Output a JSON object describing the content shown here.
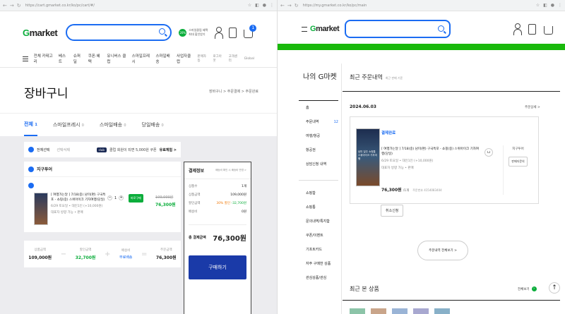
{
  "left": {
    "browser": {
      "url": "https://cart.gmarket.co.kr/ko/pc/cart/#/"
    },
    "header": {
      "logo_g": "G",
      "logo_rest": "market",
      "promo_badge": "20%",
      "promo_text1": "스마일클럽 혜택",
      "promo_text2": "최대 할인받기",
      "cart_count": "1"
    },
    "nav": {
      "category": "전체 카테고리",
      "items": [
        "베스트",
        "슈퍼딜",
        "쿠폰·혜택",
        "유니버스 클럽",
        "스마일프레시",
        "스마일배송",
        "사업자클럽"
      ],
      "right": [
        "판매자등",
        "로그아웃",
        "고객센터",
        "Global"
      ]
    },
    "page": {
      "title": "장바구니",
      "steps": "장바구니 > 주문결제 > 주문완료",
      "tabs": [
        {
          "label": "전체",
          "count": "1"
        },
        {
          "label": "스마일프레시",
          "count": "0"
        },
        {
          "label": "스마일배송",
          "count": "0"
        },
        {
          "label": "당일배송",
          "count": "0"
        }
      ]
    },
    "controls": {
      "select_all": "전체선택",
      "delete_selected": "선택삭제",
      "club_badge": "club",
      "club_text": "클럽 회원이 되면 5,000원 쿠폰",
      "club_link": "유료체험 >"
    },
    "seller": {
      "name": "지구투어"
    },
    "item": {
      "title": "[ 여행가는달 ] 7/18(중) 남미(편) 구국특포 - 쇼핑(중) 스위아이크 기자여행(당일)",
      "option": "6/29 토요일 • 대인1인 (+10,000원)",
      "delivery": "대표자 방향 가능 • 판매",
      "qty": "1",
      "buy_now": "바로구매",
      "price_original": "109,000원",
      "price_final": "76,300원"
    },
    "summary_row": {
      "product_label": "상품금액",
      "product_value": "109,000원",
      "discount_label": "할인금액",
      "discount_value": "32,700원",
      "ship_label": "배송비",
      "ship_value": "무료배송",
      "total_label": "주문금액",
      "total_value": "76,300원"
    },
    "checkout": {
      "title": "결제정보",
      "note": "배송비 확인 시 배송비 반영 >",
      "rows": [
        {
          "label": "상품수",
          "value": "1개"
        },
        {
          "label": "상품금액",
          "value": "109,000원"
        },
        {
          "label": "할인금액",
          "value": "-32,700원",
          "pct": "30% 할인"
        },
        {
          "label": "배송비",
          "value": "0원"
        }
      ],
      "total_label": "총 결제금액",
      "total_value": "76,300원",
      "button": "구매하기"
    }
  },
  "right": {
    "browser": {
      "url": "https://my.gmarket.co.kr/ko/pc/main"
    },
    "header": {
      "logo_g": "G",
      "logo_rest": "market"
    },
    "sidebar": {
      "title": "나의 G마켓",
      "items": [
        "홈",
        "주문내역",
        "여행/항공",
        "항공권",
        "상담신청 내역"
      ],
      "order_badge": "12",
      "items2": [
        "쇼핑함",
        "쇼핑통",
        "문의내역/특지함",
        "쿠폰/이벤트",
        "기프트카드",
        "자주 구매한 상품",
        "관심상품/관심"
      ]
    },
    "main": {
      "section_title": "최근 주문내역",
      "section_note": "최근 판매 기준",
      "date": "2024.06.03",
      "detail_link": "주문상세 >",
      "status": "결제완료",
      "item_title": "[ 여행가는달 ] 7/18(중) 남미(편) 구국특포 - 쇼핑(중) 스위아이크 기자여행(당일)",
      "item_option": "6/29 토요일 • 대인1인 (+10,000원)",
      "item_delivery": "대표자 방향 가능 • 판매",
      "price": "76,300원",
      "qty": "/1개",
      "order_no": "주문번호 4154083404",
      "cancel_btn": "취소신청",
      "seller_label": "지구투어",
      "inquiry_btn": "판매자문의",
      "more_btn": "주문내역 전체보기 >",
      "recent_title": "최근 본 상품",
      "recent_link": "전체보기"
    },
    "thumb_caption": "남미 일주 쇼핑통 스위아이크 기자여행"
  }
}
